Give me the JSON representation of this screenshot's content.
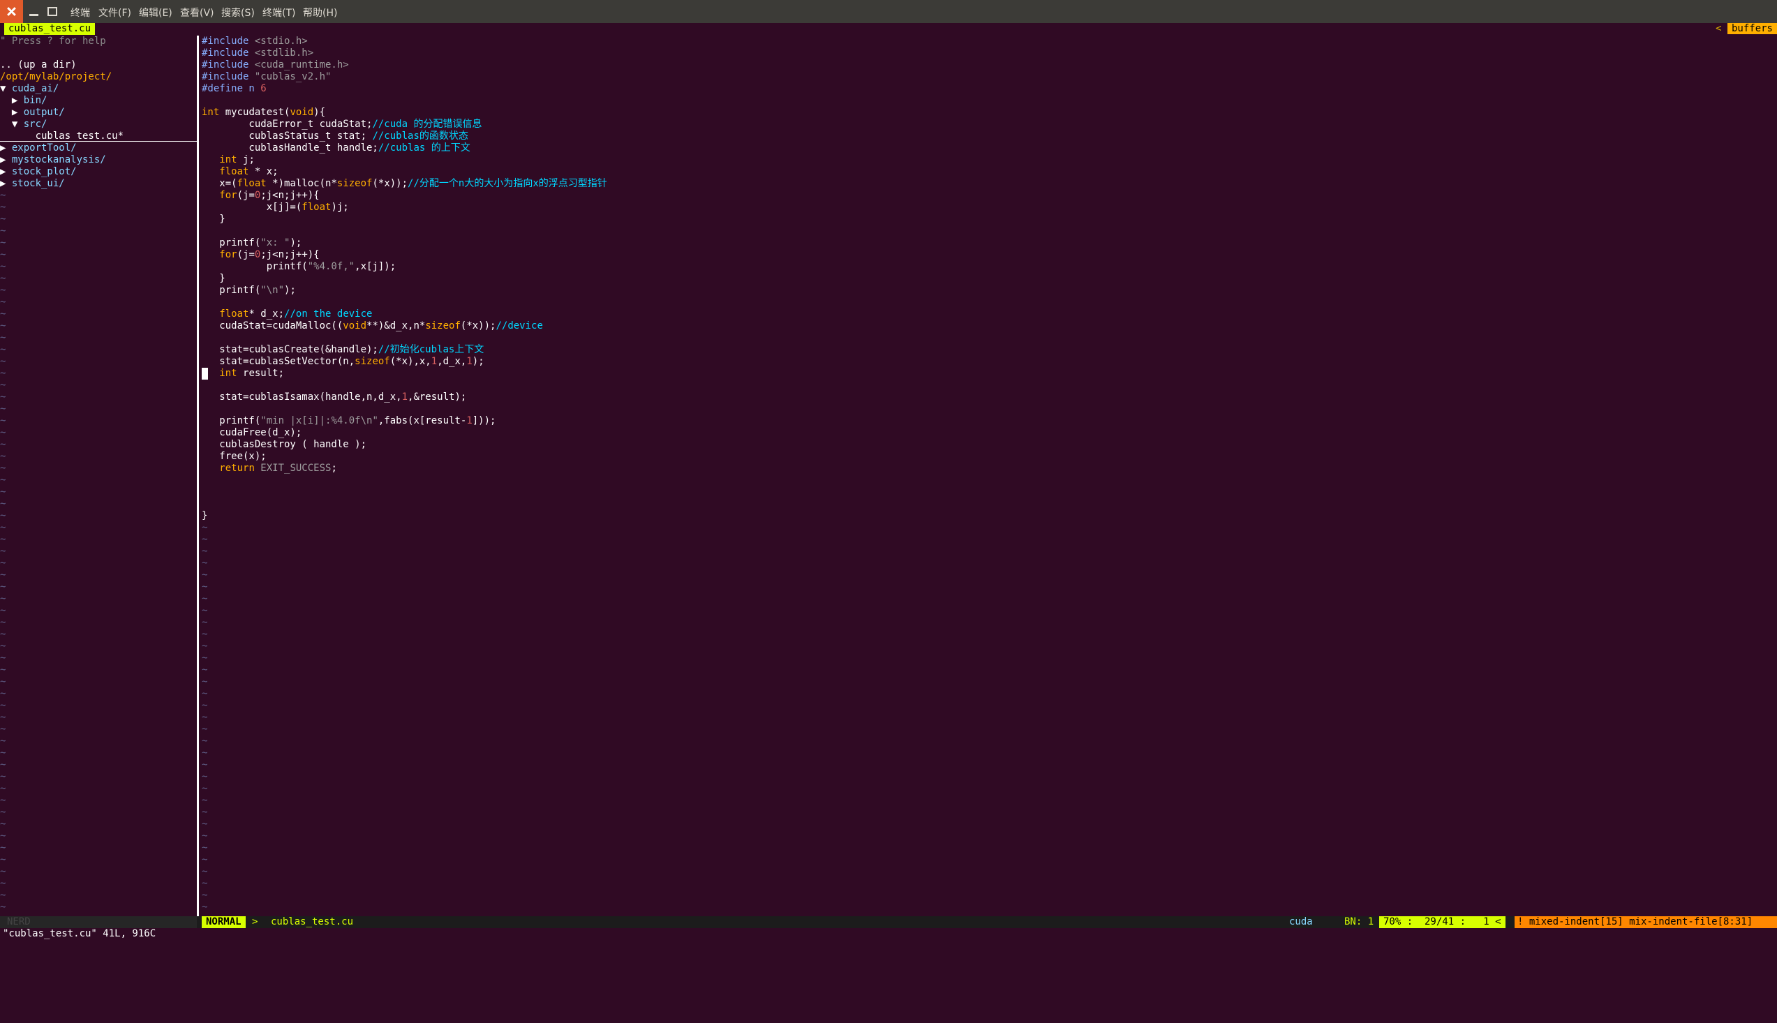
{
  "window": {
    "menu": [
      "终端",
      "文件(F)",
      "编辑(E)",
      "查看(V)",
      "搜索(S)",
      "终端(T)",
      "帮助(H)"
    ]
  },
  "tabline": {
    "current": "cublas_test.cu",
    "arrow": "<",
    "buffers": "buffers"
  },
  "nerdtree": {
    "help": "\" Press ? for help",
    "up": ".. (up a dir)",
    "root": "/opt/mylab/project/",
    "items": [
      {
        "prefix": "▼ ",
        "name": "cuda_ai/"
      },
      {
        "prefix": "  ▶ ",
        "name": "bin/"
      },
      {
        "prefix": "  ▶ ",
        "name": "output/"
      },
      {
        "prefix": "  ▼ ",
        "name": "src/"
      },
      {
        "prefix": "      ",
        "name": "cublas_test.cu*"
      },
      {
        "prefix": "▶ ",
        "name": "exportTool/"
      },
      {
        "prefix": "▶ ",
        "name": "mystockanalysis/"
      },
      {
        "prefix": "▶ ",
        "name": "stock_plot/"
      },
      {
        "prefix": "▶ ",
        "name": "stock_ui/"
      }
    ]
  },
  "code": [
    [
      [
        "pre",
        "#include "
      ],
      [
        "str",
        "<stdio.h>"
      ]
    ],
    [
      [
        "pre",
        "#include "
      ],
      [
        "str",
        "<stdlib.h>"
      ]
    ],
    [
      [
        "pre",
        "#include "
      ],
      [
        "str",
        "<cuda_runtime.h>"
      ]
    ],
    [
      [
        "pre",
        "#include "
      ],
      [
        "str",
        "\"cublas_v2.h\""
      ]
    ],
    [
      [
        "pre",
        "#define n "
      ],
      [
        "num",
        "6"
      ]
    ],
    [],
    [
      [
        "type",
        "int"
      ],
      [
        "fn",
        " mycudatest("
      ],
      [
        "type",
        "void"
      ],
      [
        "fn",
        "){"
      ]
    ],
    [
      [
        "fn",
        "        cudaError_t cudaStat;"
      ],
      [
        "cmt",
        "//cuda 的分配错误信息"
      ]
    ],
    [
      [
        "fn",
        "        cublasStatus_t stat; "
      ],
      [
        "cmt",
        "//cublas的函数状态"
      ]
    ],
    [
      [
        "fn",
        "        cublasHandle_t handle;"
      ],
      [
        "cmt",
        "//cublas 的上下文"
      ]
    ],
    [
      [
        "fn",
        "   "
      ],
      [
        "type",
        "int"
      ],
      [
        "fn",
        " j;"
      ]
    ],
    [
      [
        "fn",
        "   "
      ],
      [
        "type",
        "float"
      ],
      [
        "fn",
        " * x;"
      ]
    ],
    [
      [
        "fn",
        "   x=("
      ],
      [
        "type",
        "float"
      ],
      [
        "fn",
        " *)malloc(n*"
      ],
      [
        "kw",
        "sizeof"
      ],
      [
        "fn",
        "(*x));"
      ],
      [
        "cmt",
        "//分配一个n大的大小为指向x的浮点习型指针"
      ]
    ],
    [
      [
        "fn",
        "   "
      ],
      [
        "kw",
        "for"
      ],
      [
        "fn",
        "(j="
      ],
      [
        "num",
        "0"
      ],
      [
        "fn",
        ";j<n;j++){"
      ]
    ],
    [
      [
        "fn",
        "           x[j]=("
      ],
      [
        "type",
        "float"
      ],
      [
        "fn",
        ")j;"
      ]
    ],
    [
      [
        "fn",
        "   }"
      ]
    ],
    [],
    [
      [
        "fn",
        "   printf("
      ],
      [
        "str",
        "\"x: \""
      ],
      [
        "fn",
        ");"
      ]
    ],
    [
      [
        "fn",
        "   "
      ],
      [
        "kw",
        "for"
      ],
      [
        "fn",
        "(j="
      ],
      [
        "num",
        "0"
      ],
      [
        "fn",
        ";j<n;j++){"
      ]
    ],
    [
      [
        "fn",
        "           printf("
      ],
      [
        "str",
        "\"%4.0f,\""
      ],
      [
        "fn",
        ",x[j]);"
      ]
    ],
    [
      [
        "fn",
        "   }"
      ]
    ],
    [
      [
        "fn",
        "   printf("
      ],
      [
        "str",
        "\"\\n\""
      ],
      [
        "fn",
        ");"
      ]
    ],
    [],
    [
      [
        "fn",
        "   "
      ],
      [
        "type",
        "float"
      ],
      [
        "fn",
        "* d_x;"
      ],
      [
        "cmt",
        "//on the device"
      ]
    ],
    [
      [
        "fn",
        "   cudaStat=cudaMalloc(("
      ],
      [
        "type",
        "void"
      ],
      [
        "fn",
        "**)&d_x,n*"
      ],
      [
        "kw",
        "sizeof"
      ],
      [
        "fn",
        "(*x));"
      ],
      [
        "cmt",
        "//device"
      ]
    ],
    [],
    [
      [
        "fn",
        "   stat=cublasCreate(&handle);"
      ],
      [
        "cmt",
        "//初始化cublas上下文"
      ]
    ],
    [
      [
        "fn",
        "   stat=cublasSetVector(n,"
      ],
      [
        "kw",
        "sizeof"
      ],
      [
        "fn",
        "(*x),x,"
      ],
      [
        "num",
        "1"
      ],
      [
        "fn",
        ",d_x,"
      ],
      [
        "num",
        "1"
      ],
      [
        "fn",
        ");"
      ]
    ],
    [
      [
        "fn",
        "   "
      ],
      [
        "type",
        "int"
      ],
      [
        "fn",
        " result;"
      ]
    ],
    [],
    [
      [
        "fn",
        "   stat=cublasIsamax(handle,n,d_x,"
      ],
      [
        "num",
        "1"
      ],
      [
        "fn",
        ",&result);"
      ]
    ],
    [],
    [
      [
        "fn",
        "   printf("
      ],
      [
        "str",
        "\"min |x[i]|:%4.0f\\n\""
      ],
      [
        "fn",
        ",fabs(x[result-"
      ],
      [
        "num",
        "1"
      ],
      [
        "fn",
        "]));"
      ]
    ],
    [
      [
        "fn",
        "   cudaFree(d_x);"
      ]
    ],
    [
      [
        "fn",
        "   cublasDestroy ( handle );"
      ]
    ],
    [
      [
        "fn",
        "   free(x);"
      ]
    ],
    [
      [
        "fn",
        "   "
      ],
      [
        "kw",
        "return"
      ],
      [
        "str",
        " EXIT_SUCCESS"
      ],
      [
        "fn",
        ";"
      ]
    ],
    [],
    [],
    [],
    [
      [
        "fn",
        "}"
      ]
    ]
  ],
  "tilde": "~",
  "statusbar": {
    "nerd": "NERD",
    "mode": "NORMAL",
    "mode_sep": ">",
    "filename": "cublas_test.cu",
    "filetype": "cuda",
    "bn": "BN: 1 <",
    "position": "70% :  29/41 :   1 <",
    "warning": "! mixed-indent[15] mix-indent-file[8:31]"
  },
  "cmdline": "\"cublas_test.cu\" 41L, 916C"
}
